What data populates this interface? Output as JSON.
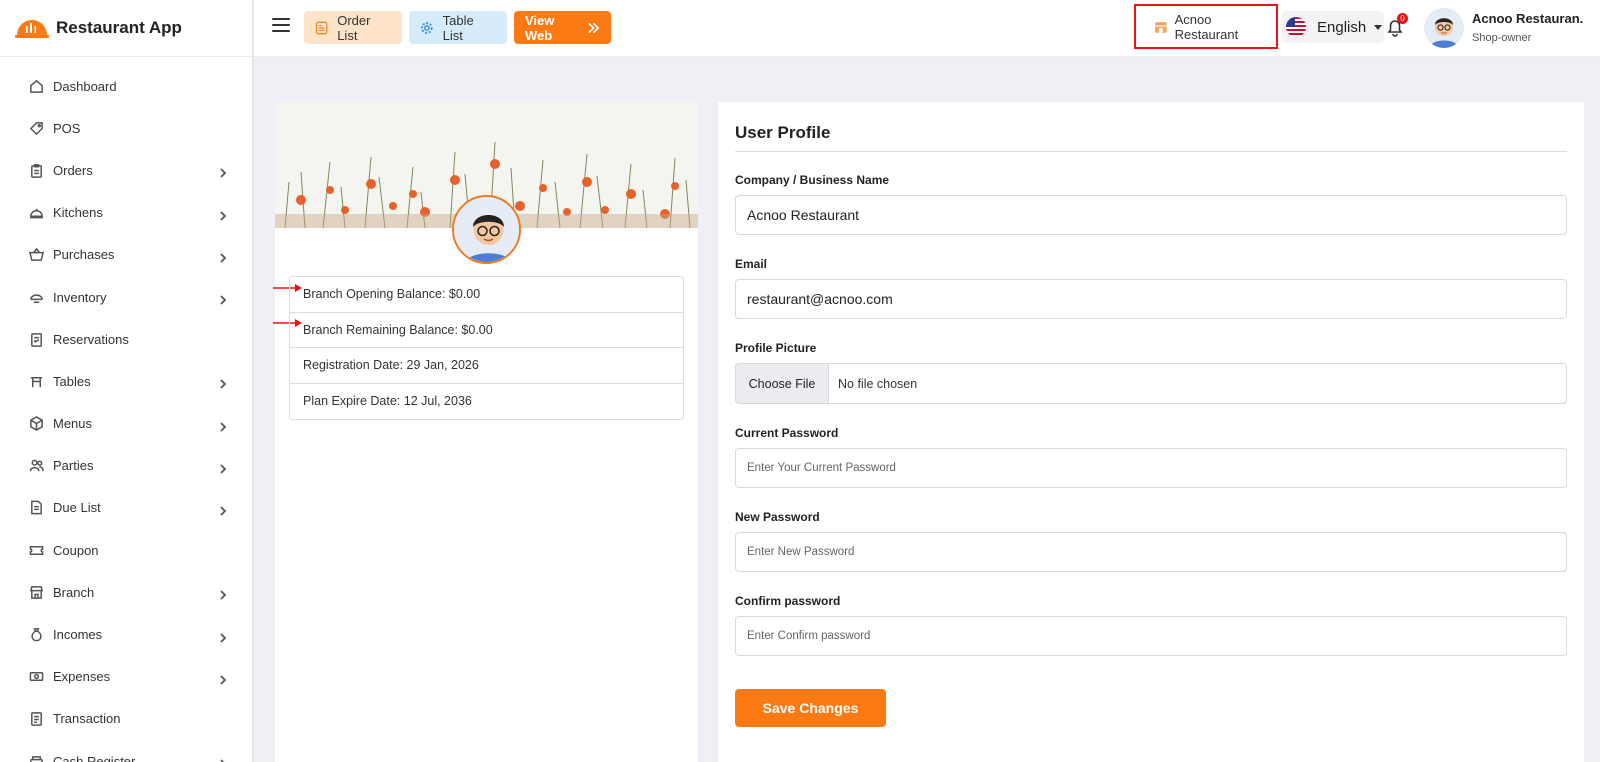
{
  "brand": {
    "name": "Restaurant App"
  },
  "sidebar": {
    "items": [
      {
        "label": "Dashboard",
        "icon": "dashboard-icon",
        "chevron": false
      },
      {
        "label": "POS",
        "icon": "tag-icon",
        "chevron": false
      },
      {
        "label": "Orders",
        "icon": "clipboard-icon",
        "chevron": true
      },
      {
        "label": "Kitchens",
        "icon": "cloche-icon",
        "chevron": true
      },
      {
        "label": "Purchases",
        "icon": "basket-icon",
        "chevron": true
      },
      {
        "label": "Inventory",
        "icon": "inventory-icon",
        "chevron": true
      },
      {
        "label": "Reservations",
        "icon": "reservation-icon",
        "chevron": false
      },
      {
        "label": "Tables",
        "icon": "table-icon",
        "chevron": true
      },
      {
        "label": "Menus",
        "icon": "box-icon",
        "chevron": true
      },
      {
        "label": "Parties",
        "icon": "users-icon",
        "chevron": true
      },
      {
        "label": "Due List",
        "icon": "document-icon",
        "chevron": true
      },
      {
        "label": "Coupon",
        "icon": "coupon-icon",
        "chevron": false
      },
      {
        "label": "Branch",
        "icon": "store-icon",
        "chevron": true
      },
      {
        "label": "Incomes",
        "icon": "money-bag-icon",
        "chevron": true
      },
      {
        "label": "Expenses",
        "icon": "cash-icon",
        "chevron": true
      },
      {
        "label": "Transaction",
        "icon": "receipt-icon",
        "chevron": false
      },
      {
        "label": "Cash Register",
        "icon": "register-icon",
        "chevron": true
      }
    ]
  },
  "topbar": {
    "order_list": "Order List",
    "table_list": "Table List",
    "view_web": "View Web",
    "store_name": "Acnoo Restaurant",
    "language": "English",
    "notification_count": "0",
    "user_name": "Acnoo Restauran.",
    "user_role": "Shop-owner"
  },
  "profile_card": {
    "rows": [
      "Branch Opening Balance: $0.00",
      "Branch Remaining Balance: $0.00",
      "Registration Date: 29 Jan, 2026",
      "Plan Expire Date: 12 Jul, 2036"
    ]
  },
  "form": {
    "title": "User Profile",
    "company_label": "Company / Business Name",
    "company_value": "Acnoo Restaurant",
    "email_label": "Email",
    "email_value": "restaurant@acnoo.com",
    "picture_label": "Profile Picture",
    "choose_file": "Choose File",
    "no_file": "No file chosen",
    "current_pw_label": "Current Password",
    "current_pw_placeholder": "Enter Your Current Password",
    "new_pw_label": "New Password",
    "new_pw_placeholder": "Enter New Password",
    "confirm_pw_label": "Confirm password",
    "confirm_pw_placeholder": "Enter Confirm password",
    "save": "Save Changes"
  },
  "colors": {
    "accent": "#fb7a13",
    "highlight": "#e11111"
  }
}
